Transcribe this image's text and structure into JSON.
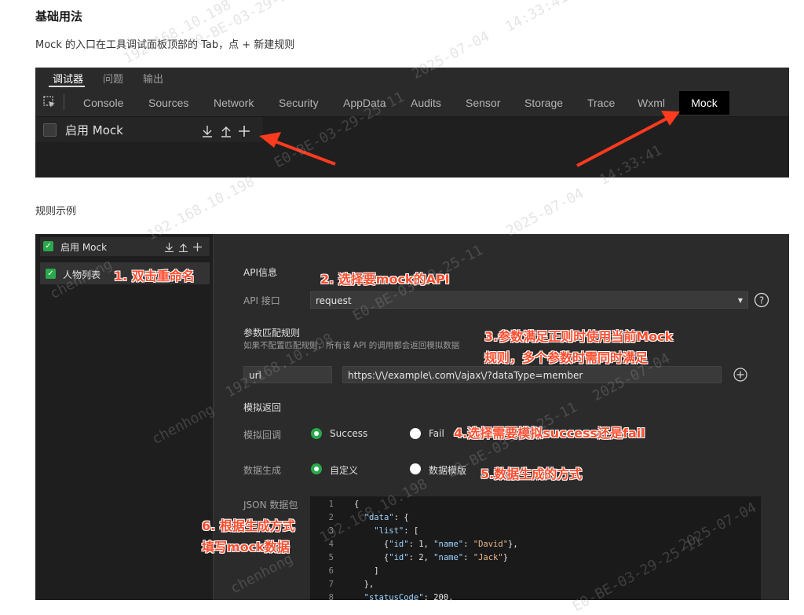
{
  "heading": "基础用法",
  "intro": "Mock 的入口在工具调试面板顶部的 Tab，点 + 新建规则",
  "panel1": {
    "subtabs": [
      "调试器",
      "问题",
      "输出"
    ],
    "tabs": [
      "Console",
      "Sources",
      "Network",
      "Security",
      "AppData",
      "Audits",
      "Sensor",
      "Storage",
      "Trace",
      "Wxml",
      "Mock"
    ],
    "enable_label": "启用 Mock"
  },
  "example_label": "规则示例",
  "panel2": {
    "enable_label": "启用 Mock",
    "rule_name": "人物列表",
    "api_section": "API信息",
    "api_label": "API 接口",
    "api_value": "request",
    "param_title": "参数匹配规则",
    "param_desc": "如果不配置匹配规则，所有该 API 的调用都会返回模拟数据",
    "param_key": "url",
    "param_value": "https:\\/\\/example\\.com\\/ajax\\/?dataType=member",
    "mock_return": "模拟返回",
    "callback_label": "模拟回调",
    "success": "Success",
    "fail": "Fail",
    "data_gen_label": "数据生成",
    "custom": "自定义",
    "template": "数据模版",
    "json_label": "JSON 数据包",
    "code_lines": [
      "1",
      "2",
      "3",
      "4",
      "5",
      "6",
      "7",
      "8"
    ]
  },
  "annotations": {
    "a1": "1. 双击重命名",
    "a2": "2. 选择要mock的API",
    "a3_1": "3.参数满足正则时使用当前Mock",
    "a3_2": "规则，多个参数时需同时满足",
    "a4": "4.选择需要模拟success还是fail",
    "a5": "5.数据生成的方式",
    "a6_1": "6. 根据生成方式",
    "a6_2": "填写mock数据"
  },
  "watermarks": [
    "192.168.10.198",
    "E0-BE-03-29-25-11",
    "2025-07-04",
    "14:33:41",
    "chenhong"
  ],
  "colors": {
    "accent_green": "#2aa94c",
    "annotation_red": "#ff4d2e",
    "panel_bg": "#2b2b2b"
  }
}
